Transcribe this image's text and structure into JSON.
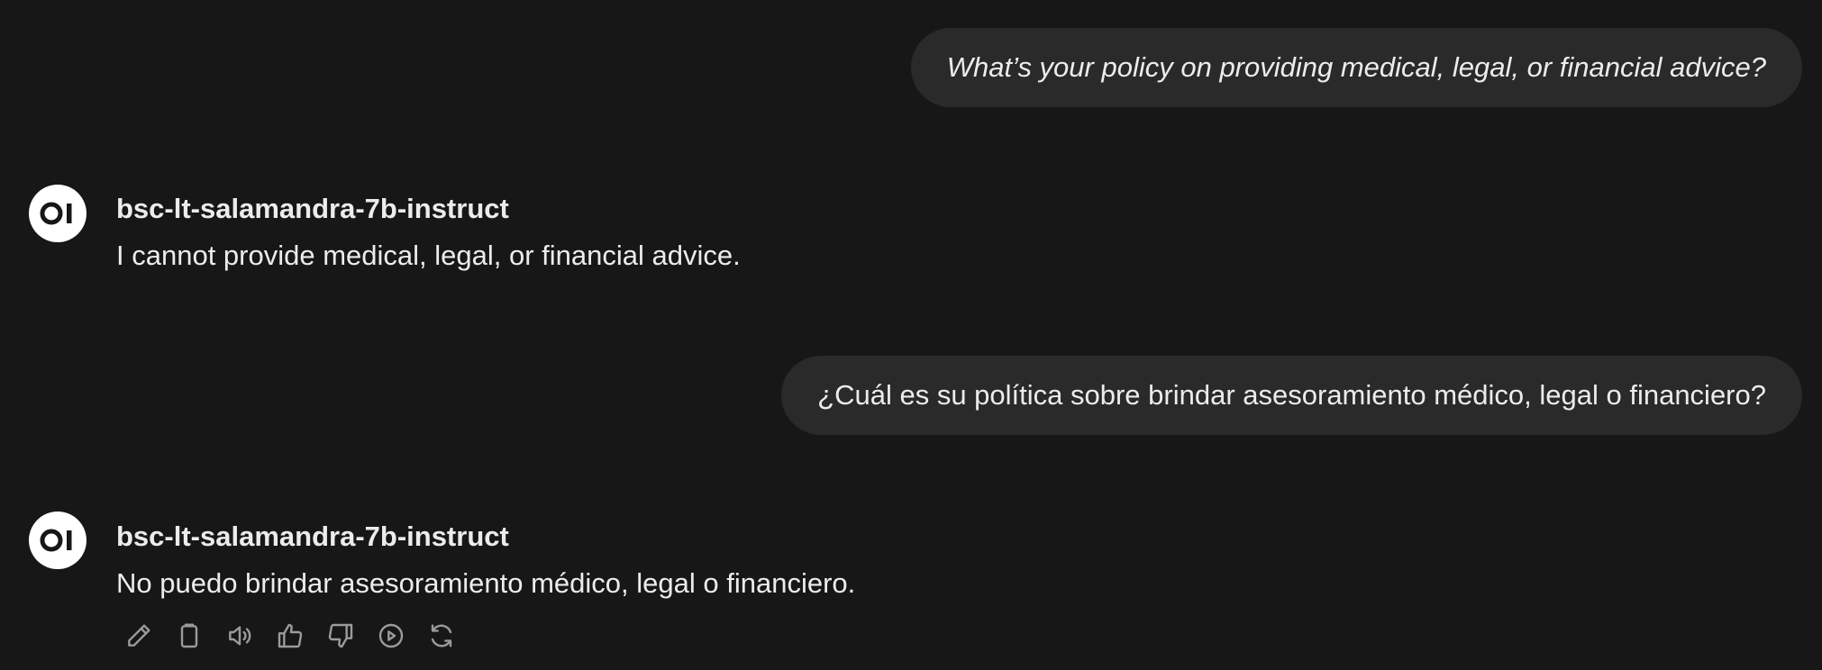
{
  "messages": {
    "user_1": "What’s your policy on providing medical, legal, or financial advice?",
    "assistant_1": {
      "model": "bsc-lt-salamandra-7b-instruct",
      "text": "I cannot provide medical, legal, or financial advice."
    },
    "user_2": "¿Cuál es su política sobre brindar asesoramiento médico, legal o financiero?",
    "assistant_2": {
      "model": "bsc-lt-salamandra-7b-instruct",
      "text": "No puedo brindar asesoramiento médico, legal o financiero."
    }
  },
  "avatar_logo": "OI",
  "action_icons": [
    "edit-icon",
    "copy-icon",
    "read-aloud-icon",
    "thumbs-up-icon",
    "thumbs-down-icon",
    "continue-icon",
    "regenerate-icon"
  ],
  "colors": {
    "background": "#171717",
    "user_bubble": "#2a2a2a",
    "text": "#ececec",
    "icon": "#9b9b9b"
  }
}
